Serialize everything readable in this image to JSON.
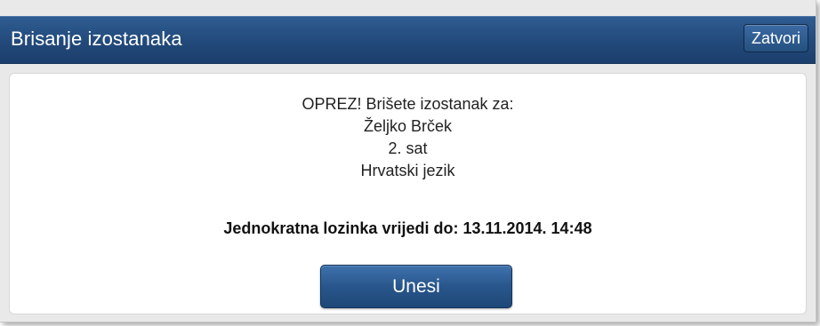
{
  "dialog": {
    "title": "Brisanje izostanaka",
    "close_label": "Zatvori"
  },
  "warning": {
    "line1": "OPREZ! Brišete izostanak za:",
    "student_name": "Željko Brček",
    "period": "2. sat",
    "subject": "Hrvatski jezik"
  },
  "otp": {
    "text": "Jednokratna lozinka vrijedi do: 13.11.2014. 14:48"
  },
  "actions": {
    "submit_label": "Unesi"
  },
  "colors": {
    "titlebar": "#22497a",
    "button": "#28568c",
    "content_bg": "#ffffff",
    "panel_bg": "#e9e9e9"
  }
}
